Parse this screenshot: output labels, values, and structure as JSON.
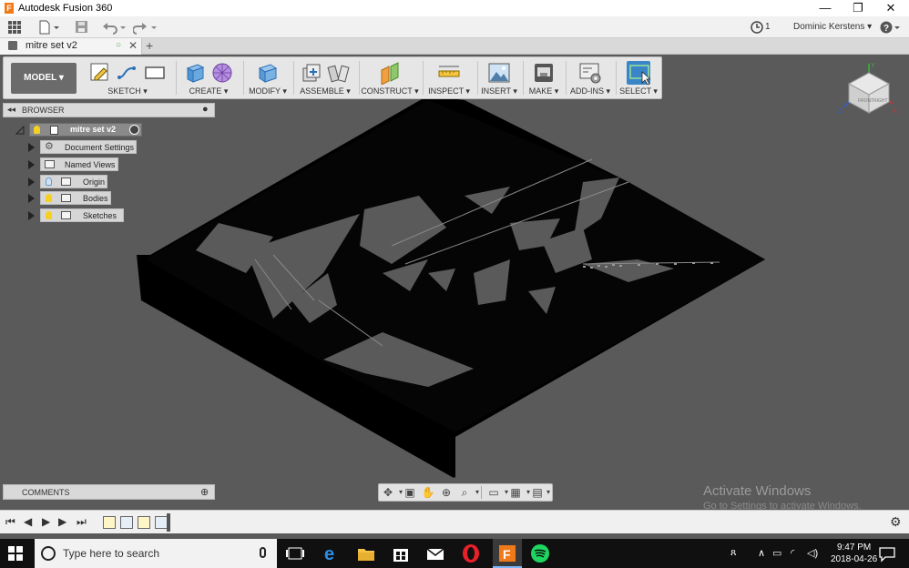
{
  "window": {
    "title": "Autodesk Fusion 360",
    "app_icon_letter": "F",
    "minimize": "—",
    "restore": "❐",
    "close": "✕"
  },
  "quickbar": {
    "jobs_count": "1",
    "user_name": "Dominic Kerstens ▾",
    "help": "?"
  },
  "document": {
    "tab_label": "mitre set v2",
    "new_tab": "+"
  },
  "ribbon": {
    "workspace": "MODEL ▾",
    "groups": [
      {
        "label": "SKETCH ▾"
      },
      {
        "label": "CREATE ▾"
      },
      {
        "label": "MODIFY ▾"
      },
      {
        "label": "ASSEMBLE ▾"
      },
      {
        "label": "CONSTRUCT ▾"
      },
      {
        "label": "INSPECT ▾"
      },
      {
        "label": "INSERT ▾"
      },
      {
        "label": "MAKE ▾"
      },
      {
        "label": "ADD-INS ▾"
      },
      {
        "label": "SELECT ▾"
      }
    ]
  },
  "browser": {
    "title": "BROWSER",
    "root": "mitre set v2",
    "items": [
      {
        "label": "Document Settings",
        "icon": "gear-icon"
      },
      {
        "label": "Named Views",
        "icon": "folder-icon"
      },
      {
        "label": "Origin",
        "icon": "folder-icon"
      },
      {
        "label": "Bodies",
        "icon": "folder-icon"
      },
      {
        "label": "Sketches",
        "icon": "folder-icon"
      }
    ]
  },
  "viewcube": {
    "front": "FRONT",
    "right": "RIGHT",
    "axis_x": "X",
    "axis_y": "Y",
    "axis_z": "Z"
  },
  "comments": {
    "title": "COMMENTS"
  },
  "watermark": {
    "line1": "Activate Windows",
    "line2": "Go to Settings to activate Windows."
  },
  "taskbar": {
    "search_placeholder": "Type here to search",
    "time": "9:47 PM",
    "date": "2018-04-26"
  },
  "colors": {
    "accent": "#3a85c8",
    "model": "#000000",
    "viewport_bg": "#5a5a5a",
    "bulb": "#f5d020"
  }
}
